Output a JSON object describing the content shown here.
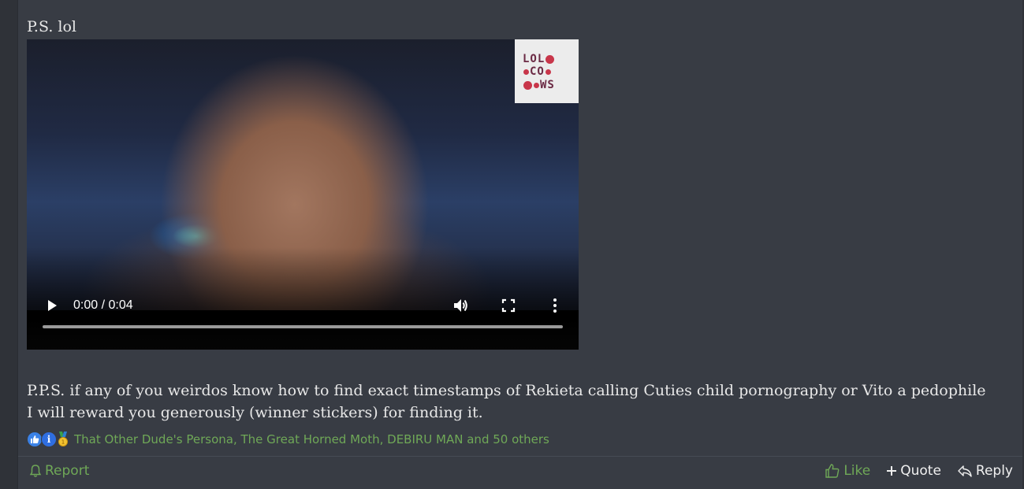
{
  "post": {
    "ps_text": "P.S. lol",
    "pps_text": "P.P.S. if any of you weirdos know how to find exact timestamps of Rekieta calling Cuties child pornography or Vito a pedophile I will reward you generously (winner stickers) for finding it."
  },
  "video": {
    "time_display": "0:00 / 0:04",
    "progress": 0,
    "watermark": {
      "row1": "LOL",
      "row2": "CO",
      "row3": "WS"
    }
  },
  "reactions": {
    "icons": [
      "like-icon",
      "info-icon",
      "medal-icon"
    ],
    "users_text": "That Other Dude's Persona, The Great Horned Moth, DEBIRU MAN and 50 others"
  },
  "footer": {
    "report_label": "Report",
    "like_label": "Like",
    "quote_label": "Quote",
    "reply_label": "Reply"
  },
  "colors": {
    "accent_green": "#6fa857",
    "post_bg": "#383c44",
    "page_bg": "#2f3238"
  }
}
